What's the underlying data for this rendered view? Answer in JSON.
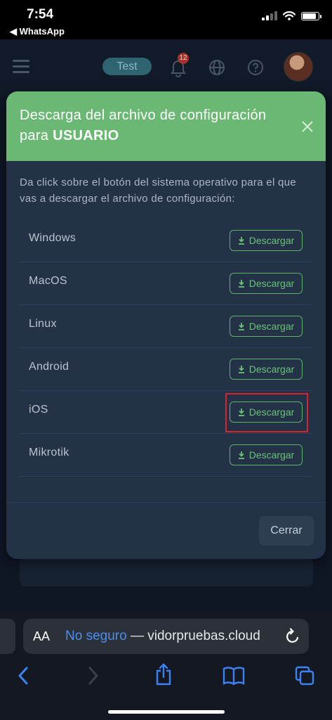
{
  "status_bar": {
    "time": "7:54",
    "back_app": "◀ WhatsApp"
  },
  "header": {
    "test_label": "Test",
    "notification_count": "12"
  },
  "modal": {
    "title_line1": "Descarga del archivo de configuración",
    "title_prefix": "para",
    "title_user": "USUARIO",
    "intro": "Da click sobre el botón del sistema operativo para el que vas a descargar el archivo de configuración:",
    "os_list": [
      {
        "name": "Windows",
        "button": "Descargar"
      },
      {
        "name": "MacOS",
        "button": "Descargar"
      },
      {
        "name": "Linux",
        "button": "Descargar"
      },
      {
        "name": "Android",
        "button": "Descargar"
      },
      {
        "name": "iOS",
        "button": "Descargar"
      },
      {
        "name": "Mikrotik",
        "button": "Descargar"
      }
    ],
    "close_button": "Cerrar"
  },
  "safari": {
    "aa_label": "AA",
    "url_insecure": "No seguro",
    "url_separator": " — ",
    "url_host": "vidorpruebas.cloud"
  },
  "colors": {
    "accent_green": "#6ab874",
    "modal_bg": "#233247",
    "highlight_red": "#d8232a",
    "link_blue": "#4a8ef0"
  }
}
